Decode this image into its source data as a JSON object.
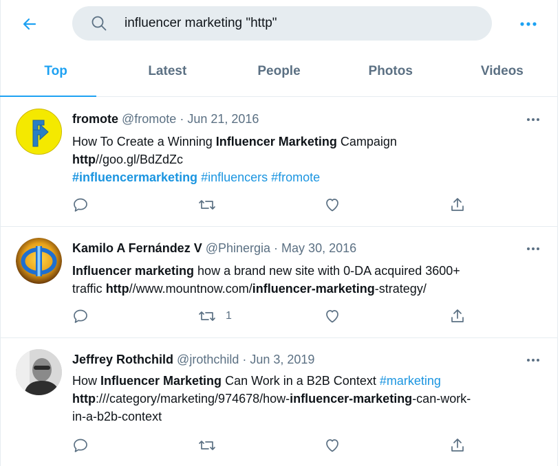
{
  "search": {
    "query": "influencer marketing \"http\""
  },
  "tabs": [
    {
      "label": "Top",
      "active": true
    },
    {
      "label": "Latest",
      "active": false
    },
    {
      "label": "People",
      "active": false
    },
    {
      "label": "Photos",
      "active": false
    },
    {
      "label": "Videos",
      "active": false
    }
  ],
  "colors": {
    "accent": "#1da1f2",
    "link": "#1b95e0",
    "muted": "#5b7083",
    "search_bg": "#e6ecf0"
  },
  "tweets": [
    {
      "name": "fromote",
      "handle": "@fromote",
      "sep": " · ",
      "date": "Jun 21, 2016",
      "line1": {
        "a": "How To Create a Winning ",
        "b": "Influencer Marketing",
        "c": " Campaign"
      },
      "line2": {
        "a": "http",
        "b": "//goo.gl/BdZdZc"
      },
      "line3": {
        "a": "#influencermarketing",
        "b": " #influencers #fromote"
      },
      "retweets": ""
    },
    {
      "name": "Kamilo A Fernández V",
      "handle": "@Phinergia",
      "sep": " · ",
      "date": "May 30, 2016",
      "line1": {
        "a": "Influencer marketing",
        "b": " how a brand new site with 0-DA acquired 3600+"
      },
      "line2": {
        "a": "traffic ",
        "b": "http",
        "c": "//www.mountnow.com/",
        "d": "influencer-marketing",
        "e": "-strategy/"
      },
      "retweets": "1"
    },
    {
      "name": "Jeffrey Rothchild",
      "handle": "@jrothchild",
      "sep": " · ",
      "date": "Jun 3, 2019",
      "line1": {
        "a": "How ",
        "b": "Influencer Marketing",
        "c": " Can Work in a B2B Context ",
        "d": "#marketing"
      },
      "line2": {
        "a": "http",
        "b": ":///category/marketing/974678/how-",
        "c": "influencer-marketing",
        "d": "-can-work-"
      },
      "line3": {
        "a": "in-a-b2b-context"
      },
      "retweets": ""
    }
  ]
}
